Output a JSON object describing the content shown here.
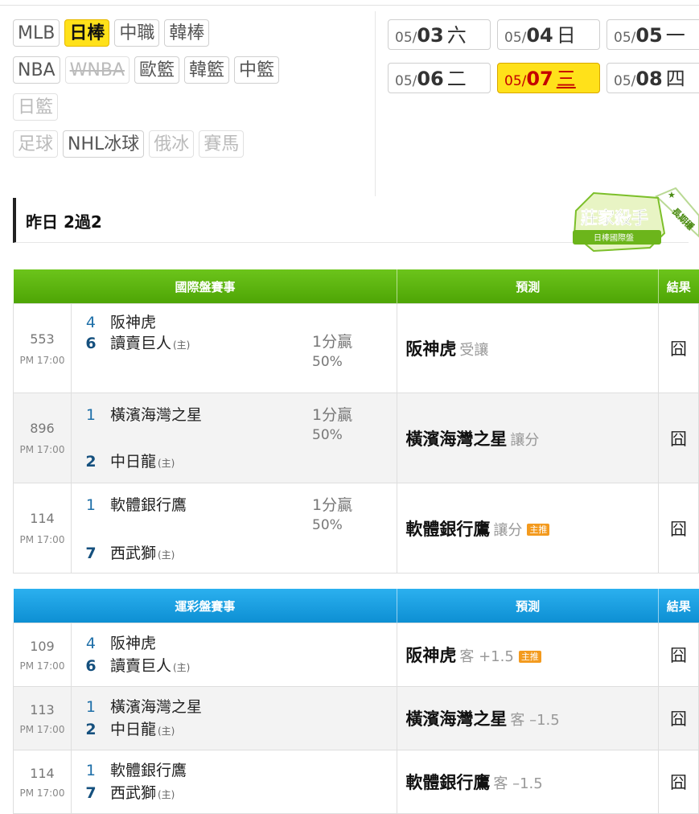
{
  "leagues": {
    "rows": [
      [
        {
          "label": "MLB"
        },
        {
          "label": "日棒",
          "active": true
        },
        {
          "label": "中職"
        },
        {
          "label": "韓棒"
        }
      ],
      [
        {
          "label": "NBA"
        },
        {
          "label": "WNBA",
          "dim": true,
          "strike": true
        },
        {
          "label": "歐籃"
        },
        {
          "label": "韓籃"
        },
        {
          "label": "中籃"
        }
      ],
      [
        {
          "label": "日籃",
          "dim": true
        }
      ],
      [
        {
          "label": "足球",
          "dim": true
        },
        {
          "label": "NHL冰球"
        },
        {
          "label": "俄冰",
          "dim": true
        },
        {
          "label": "賽馬",
          "dim": true
        }
      ]
    ]
  },
  "dates": [
    {
      "month": "05/",
      "day": "03",
      "weekday": "六",
      "active": false
    },
    {
      "month": "05/",
      "day": "04",
      "weekday": "日",
      "active": false
    },
    {
      "month": "05/",
      "day": "05",
      "weekday": "一",
      "active": false
    },
    {
      "month": "05/",
      "day": "06",
      "weekday": "二",
      "active": false
    },
    {
      "month": "05/",
      "day": "07",
      "weekday": "三",
      "active": true
    },
    {
      "month": "05/",
      "day": "08",
      "weekday": "四",
      "active": false
    }
  ],
  "yesterday": {
    "label": "昨日 2過2"
  },
  "badge": {
    "title": "莊家殺手",
    "subtitle": "日棒國際盤",
    "ribbon": "長期穩"
  },
  "colors": {
    "green_header": "#5ab510",
    "blue_header": "#1a9de0",
    "active_yellow": "#ffe11a",
    "tag_orange": "#f39a1e"
  },
  "international": {
    "headers": [
      "國際盤賽事",
      "預測",
      "結果"
    ],
    "rows": [
      {
        "id": "553",
        "time": "PM 17:00",
        "away_score": "4",
        "away": "阪神虎",
        "home_score": "6",
        "home": "讀賣巨人",
        "host_mark": "(主)",
        "odds_line": "1分贏",
        "odds_pct": "50%",
        "pred_team": "阪神虎",
        "pred_sub": "受讓",
        "tag": "",
        "result": "囧"
      },
      {
        "id": "896",
        "time": "PM 17:00",
        "away_score": "1",
        "away": "橫濱海灣之星",
        "home_score": "2",
        "home": "中日龍",
        "host_mark": "(主)",
        "odds_line": "1分贏",
        "odds_pct": "50%",
        "pred_team": "橫濱海灣之星",
        "pred_sub": "讓分",
        "tag": "",
        "result": "囧"
      },
      {
        "id": "114",
        "time": "PM 17:00",
        "away_score": "1",
        "away": "軟體銀行鷹",
        "home_score": "7",
        "home": "西武獅",
        "host_mark": "(主)",
        "odds_line": "1分贏",
        "odds_pct": "50%",
        "pred_team": "軟體銀行鷹",
        "pred_sub": "讓分",
        "tag": "主推",
        "result": "囧"
      }
    ]
  },
  "sportslottery": {
    "headers": [
      "運彩盤賽事",
      "預測",
      "結果"
    ],
    "rows": [
      {
        "id": "109",
        "time": "PM 17:00",
        "away_score": "4",
        "away": "阪神虎",
        "home_score": "6",
        "home": "讀賣巨人",
        "host_mark": "(主)",
        "pred_team": "阪神虎",
        "pred_sub": "客 +1.5",
        "tag": "主推",
        "result": "囧"
      },
      {
        "id": "113",
        "time": "PM 17:00",
        "away_score": "1",
        "away": "橫濱海灣之星",
        "home_score": "2",
        "home": "中日龍",
        "host_mark": "(主)",
        "pred_team": "橫濱海灣之星",
        "pred_sub": "客 –1.5",
        "tag": "",
        "result": "囧"
      },
      {
        "id": "114",
        "time": "PM 17:00",
        "away_score": "1",
        "away": "軟體銀行鷹",
        "home_score": "7",
        "home": "西武獅",
        "host_mark": "(主)",
        "pred_team": "軟體銀行鷹",
        "pred_sub": "客 –1.5",
        "tag": "",
        "result": "囧"
      }
    ]
  }
}
